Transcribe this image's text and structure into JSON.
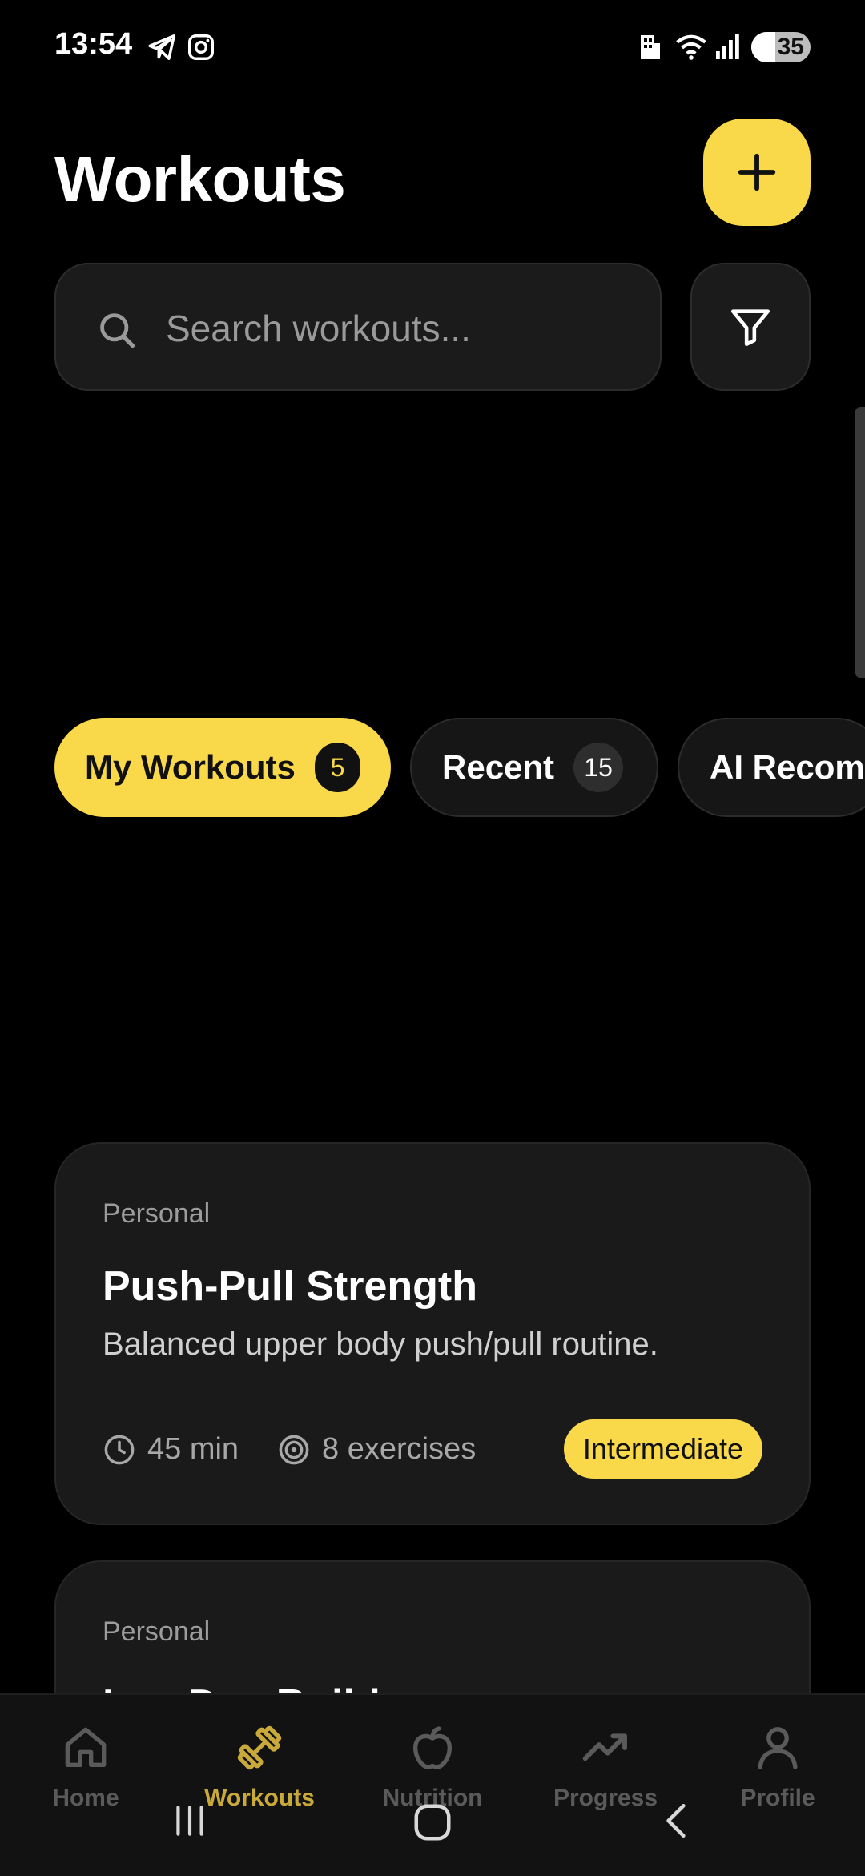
{
  "status_bar": {
    "time": "13:54",
    "battery": "35"
  },
  "header": {
    "title": "Workouts"
  },
  "search": {
    "placeholder": "Search workouts..."
  },
  "tabs": [
    {
      "label": "My Workouts",
      "count": "5"
    },
    {
      "label": "Recent",
      "count": "15"
    },
    {
      "label": "AI Recomm"
    }
  ],
  "cards": [
    {
      "category": "Personal",
      "title": "Push-Pull Strength",
      "description": "Balanced upper body push/pull routine.",
      "duration": "45 min",
      "exercises": "8 exercises",
      "level": "Intermediate"
    },
    {
      "category": "Personal",
      "title": "Leg Day Builder"
    }
  ],
  "nav": {
    "items": [
      {
        "label": "Home",
        "icon": "home-icon"
      },
      {
        "label": "Workouts",
        "icon": "dumbbell-icon"
      },
      {
        "label": "Nutrition",
        "icon": "apple-icon"
      },
      {
        "label": "Progress",
        "icon": "trending-up-icon"
      },
      {
        "label": "Profile",
        "icon": "user-icon"
      }
    ]
  },
  "colors": {
    "accent": "#f9d84a",
    "background": "#000000",
    "card": "#1a1a1a",
    "nav_active": "#c8a93a"
  }
}
